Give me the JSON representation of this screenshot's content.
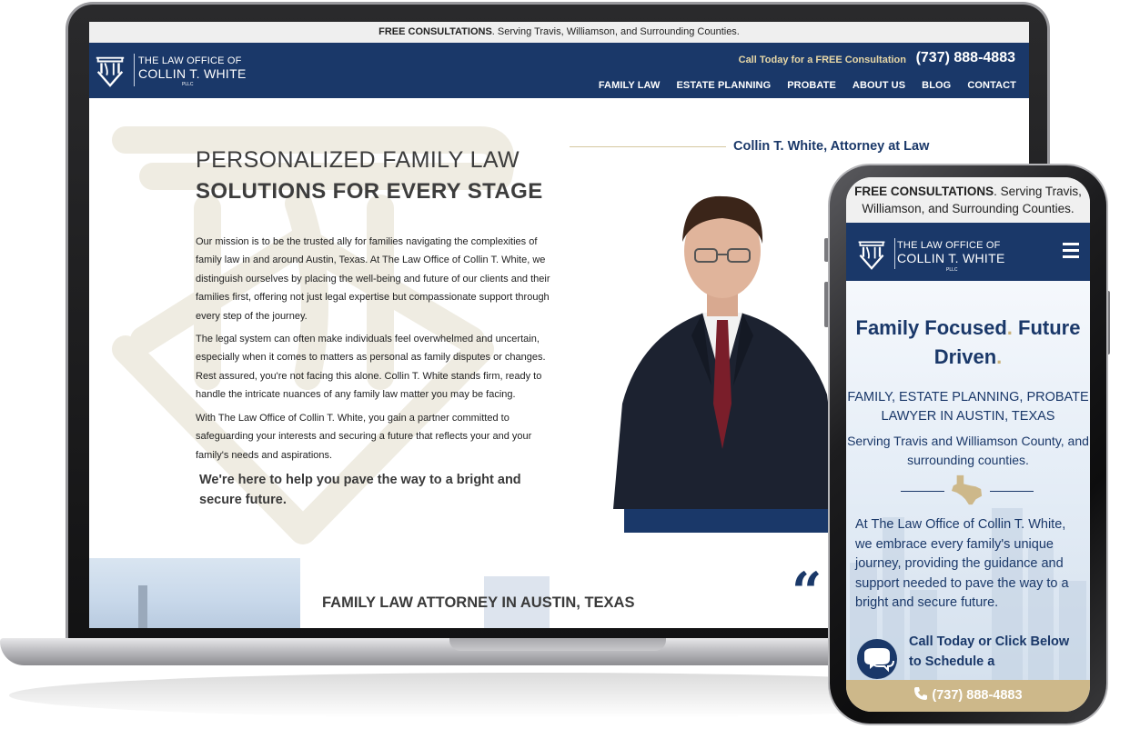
{
  "desktop": {
    "topbar": {
      "bold": "FREE CONSULTATIONS",
      "rest": ". Serving Travis, Williamson, and Surrounding Counties."
    },
    "logo": {
      "line1": "THE LAW OFFICE OF",
      "line2": "COLLIN T. WHITE",
      "line3": "PLLC"
    },
    "call": {
      "text": "Call Today for a FREE Consultation",
      "phone": "(737) 888-4883"
    },
    "menu": [
      "FAMILY LAW",
      "ESTATE PLANNING",
      "PROBATE",
      "ABOUT US",
      "BLOG",
      "CONTACT"
    ],
    "hero": {
      "title_line1": "PERSONALIZED FAMILY LAW",
      "title_line2": "SOLUTIONS FOR EVERY STAGE",
      "paragraph1": "Our mission is to be the trusted ally for families navigating the complexities of family law in and around Austin, Texas. At The Law Office of Collin T. White, we distinguish ourselves by placing the well-being and future of our clients and their families first, offering not just legal expertise but compassionate support through every step of the journey.",
      "paragraph2": "The legal system can often make individuals feel overwhelmed and uncertain, especially when it comes to matters as personal as family disputes or changes. Rest assured, you're not facing this alone. Collin T. White stands firm, ready to handle the intricate nuances of any family law matter you may be facing.",
      "paragraph3": "With The Law Office of Collin T. White, you gain a partner committed to safeguarding your interests and securing a future that reflects your and your family's needs and aspirations.",
      "closing": "We're here to help you pave the way to a bright and secure future."
    },
    "attorney_caption": "Collin T. White, Attorney at Law",
    "section2_title": "FAMILY LAW ATTORNEY IN AUSTIN, TEXAS",
    "quote_glyph": "“"
  },
  "mobile": {
    "topbar": {
      "bold": "FREE CONSULTATIONS",
      "rest": ". Serving Travis, Williamson, and Surrounding Counties."
    },
    "headline_part1": "Family Focused",
    "headline_part2": "Future Driven",
    "dot": ".",
    "subhead": "FAMILY, ESTATE PLANNING, PROBATE LAWYER IN AUSTIN, TEXAS",
    "serving": "Serving Travis and Williamson County, and surrounding counties.",
    "body": "At The Law Office of Collin T. White, we embrace every family's unique journey, providing the guidance and support needed to pave the way to a bright and secure future.",
    "cta": "Call Today or Click Below to Schedule a",
    "phone": "(737) 888-4883"
  },
  "colors": {
    "navy": "#1a3869",
    "gold": "#cdb88a",
    "topbar": "#efefef"
  },
  "icons": [
    "ctw-monogram-icon",
    "hamburger-icon",
    "texas-icon",
    "chat-bubbles-icon",
    "phone-icon"
  ]
}
